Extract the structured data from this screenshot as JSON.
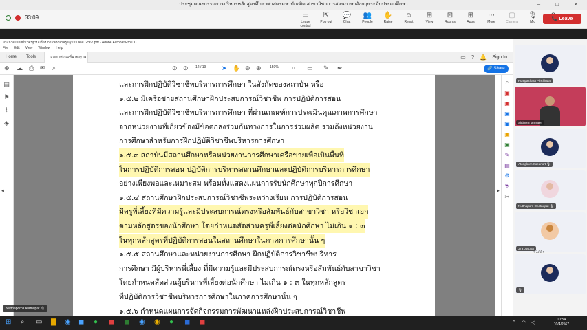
{
  "zoom": {
    "window_title": "ประชุมคณะกรรมการบริหารหลักสูตรศึกษาศาสตรมหาบัณฑิต สาขาวิชาการสอนภาษาอังกฤษระดับประถมศึกษา",
    "window_controls": "– □ ×",
    "timer": "33:09",
    "toolbar": [
      {
        "icon": "▭",
        "label": "Leave control",
        "name": "leave-control"
      },
      {
        "icon": "⇱",
        "label": "Pop out",
        "name": "pop-out"
      },
      {
        "icon": "💬",
        "label": "Chat",
        "name": "chat"
      },
      {
        "icon": "👥",
        "label": "People",
        "name": "people"
      },
      {
        "icon": "✋",
        "label": "Raise",
        "name": "raise"
      },
      {
        "icon": "☺",
        "label": "React",
        "name": "react"
      },
      {
        "icon": "⊞",
        "label": "View",
        "name": "view"
      },
      {
        "icon": "⊡",
        "label": "Rooms",
        "name": "rooms"
      },
      {
        "icon": "⊞",
        "label": "Apps",
        "name": "apps"
      },
      {
        "icon": "⋯",
        "label": "More",
        "name": "more"
      },
      {
        "icon": "▢",
        "label": "Camera",
        "name": "camera",
        "dim": true
      },
      {
        "icon": "🎙",
        "label": "Mic",
        "name": "mic"
      },
      {
        "icon": "⇧",
        "label": "Share",
        "name": "share"
      }
    ],
    "leave_label": "📞 Leave"
  },
  "acrobat": {
    "title": "ประกาศเกณฑ์มาตรฐาน เรื่อง การพัฒนาครูปฐมวัย พ.ศ. 2567.pdf - Adobe Acrobat Pro DC",
    "menu": [
      "File",
      "Edit",
      "View",
      "Window",
      "Help"
    ],
    "tabs": {
      "home": "Home",
      "tools": "Tools",
      "doc": "ประกาศเกณฑ์มาตรฐานฯ เรื่อง กา..."
    },
    "sign_in": "Sign In",
    "page_indicator": "12 / 19",
    "zoom_level": "150%",
    "share_label": "🔗 Share"
  },
  "document": {
    "lines": [
      {
        "text": "และการฝึกปฏิบัติวิชาชีพบริหารการศึกษา ในสังกัดของสถาบัน หรือ",
        "hl": false
      },
      {
        "text": "        ๑.๕.๒ มีเครือข่ายสถานศึกษาฝึกประสบการณ์วิชาชีพ การปฏิบัติการสอน",
        "hl": false
      },
      {
        "text": "และการฝึกปฏิบัติวิชาชีพบริหารการศึกษา ที่ผ่านเกณฑ์การประเมินคุณภาพการศึกษา",
        "hl": false
      },
      {
        "text": "จากหน่วยงานที่เกี่ยวข้องมีข้อตกลงร่วมกันทางการในการร่วมผลิต รวมถึงหน่วยงาน",
        "hl": false
      },
      {
        "text": "การศึกษาสำหรับการฝึกปฏิบัติวิชาชีพบริหารการศึกษา",
        "hl": false
      },
      {
        "text": "        ๑.๕.๓ สถาบันมีสถานศึกษาหรือหน่วยงานการศึกษาเครือข่ายเพื่อเป็นพื้นที่",
        "hl": true
      },
      {
        "text": "ในการปฏิบัติการสอน ปฏิบัติการบริหารสถานศึกษาและปฏิบัติการบริหารการศึกษา",
        "hl": true
      },
      {
        "text": "อย่างเพียงพอและเหมาะสม พร้อมทั้งแสดงแผนการรับนักศึกษาทุกปีการศึกษา",
        "hl": false
      },
      {
        "text": "        ๑.๕.๔ สถานศึกษาฝึกประสบการณ์วิชาชีพระหว่างเรียน การปฏิบัติการสอน",
        "hl": false
      },
      {
        "text": "มีครูพี่เลี้ยงที่มีความรู้และมีประสบการณ์ตรงหรือสัมพันธ์กับสาขาวิชา หรือวิชาเอก",
        "hl": true
      },
      {
        "text": "ตามหลักสูตรของนักศึกษา โดยกำหนดสัดส่วนครูพี่เลี้ยงต่อนักศึกษา ไม่เกิน ๑ : ๓",
        "hl": true
      },
      {
        "text": "ในทุกหลักสูตรที่ปฏิบัติการสอนในสถานศึกษาในภาคการศึกษานั้น ๆ",
        "hl": true
      },
      {
        "text": "        ๑.๕.๕ สถานศึกษาและหน่วยงานการศึกษา ฝึกปฏิบัติการวิชาชีพบริหาร",
        "hl": false
      },
      {
        "text": "การศึกษา มีผู้บริหารพี่เลี้ยง ที่มีความรู้และมีประสบการณ์ตรงหรือสัมพันธ์กับสาขาวิชา",
        "hl": false
      },
      {
        "text": "โดยกำหนดสัดส่วนผู้บริหารพี่เลี้ยงต่อนักศึกษา ไม่เกิน ๑ : ๓ ในทุกหลักสูตร",
        "hl": false
      },
      {
        "text": "ที่ปฏิบัติการวิชาชีพบริหารการศึกษาในภาคการศึกษานั้น ๆ",
        "hl": false
      },
      {
        "text": "        ๑.๕.๖ กำหนดแผนการจัดกิจกรรมการพัฒนาแหล่งฝึกประสบการณ์วิชาชีพ",
        "hl": false
      },
      {
        "text": "ที่รองรับการฝึกปฏิบัติของนักศึกษาอย่างชัดเจน",
        "hl": false
      }
    ]
  },
  "presenter_tag": "Nutthaporn Oeatnupat 🎙",
  "participants": [
    {
      "name": "Pornpachara Pinchinda",
      "kind": "avatar",
      "style": ""
    },
    {
      "name": "Sittiporn Iamsaen",
      "kind": "video",
      "style": ""
    },
    {
      "name": "Atongkorn Koednort 🎙",
      "kind": "avatar",
      "style": ""
    },
    {
      "name": "Nutthaporn Oeatnupat 🎙",
      "kind": "avatar",
      "style": "pink"
    },
    {
      "name": "Jira Jitsupa",
      "kind": "avatar",
      "style": "orange"
    },
    {
      "name": "🎙",
      "kind": "avatar",
      "style": ""
    }
  ],
  "pager": "‹   1/2   ›",
  "taskbar": {
    "time": "10:54",
    "date": "10/4/2567"
  }
}
